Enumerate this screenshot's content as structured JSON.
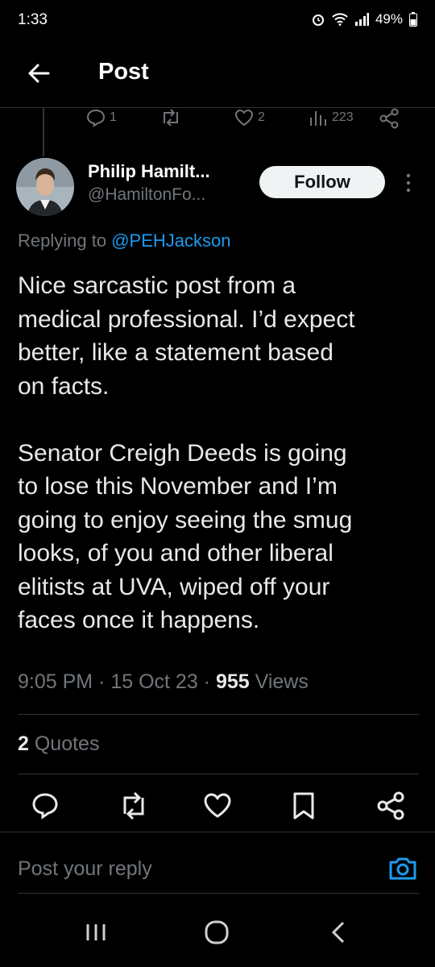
{
  "status_bar": {
    "time": "1:33",
    "battery": "49%"
  },
  "header": {
    "title": "Post"
  },
  "prev_post_actions": {
    "replies": "1",
    "likes": "2",
    "views": "223"
  },
  "author": {
    "name": "Philip Hamilt...",
    "handle": "@HamiltonFo..."
  },
  "follow_label": "Follow",
  "replying": {
    "prefix": "Replying to ",
    "mention": "@PEHJackson"
  },
  "post_text": "Nice sarcastic post from a\nmedical professional. I’d expect\nbetter, like a statement based\non facts.\n\nSenator Creigh Deeds is going\nto lose this November and I’m\ngoing to enjoy seeing the smug\nlooks, of you and other liberal\nelitists at UVA, wiped off your\nfaces once it happens.",
  "meta": {
    "time": "9:05 PM",
    "date": "15 Oct 23",
    "views_count": "955",
    "views_label": "Views"
  },
  "quotes": {
    "count": "2",
    "label": "Quotes"
  },
  "reply_box": {
    "placeholder": "Post your reply"
  },
  "colors": {
    "accent": "#1d9bf0",
    "muted": "#71767b",
    "background": "#000000"
  },
  "icons": [
    "back-arrow-icon",
    "reply-icon",
    "retweet-icon",
    "like-icon",
    "views-icon",
    "share-icon",
    "more-icon",
    "bookmark-icon",
    "camera-icon",
    "recents-icon",
    "home-icon",
    "back-icon"
  ]
}
